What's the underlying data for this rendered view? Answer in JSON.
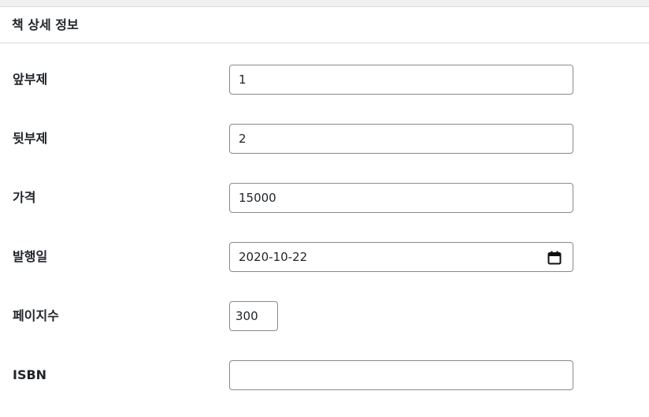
{
  "header": {
    "title": "책 상세 정보"
  },
  "fields": [
    {
      "label": "앞부제",
      "value": "1",
      "type": "text"
    },
    {
      "label": "뒷부제",
      "value": "2",
      "type": "text"
    },
    {
      "label": "가격",
      "value": "15000",
      "type": "text"
    },
    {
      "label": "발행일",
      "value": "2020-10-22",
      "type": "date",
      "icon": "calendar-icon"
    },
    {
      "label": "페이지수",
      "value": "300",
      "type": "number"
    },
    {
      "label": "ISBN",
      "value": "",
      "type": "text"
    }
  ]
}
